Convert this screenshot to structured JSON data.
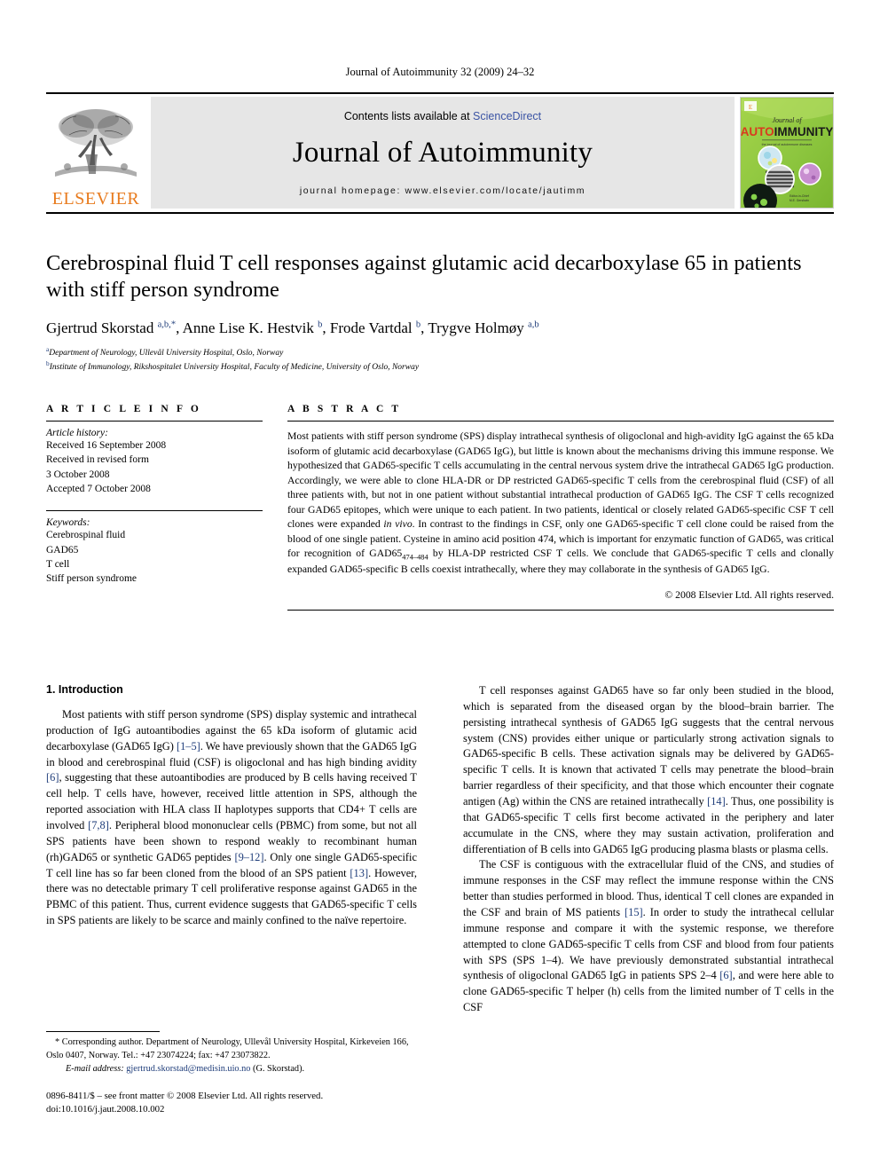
{
  "running_head": "Journal of Autoimmunity 32 (2009) 24–32",
  "banner": {
    "publisher_name": "ELSEVIER",
    "publisher_logo": "elsevier-tree-logo",
    "contents_prefix": "Contents lists available at ",
    "contents_link": "ScienceDirect",
    "journal_name": "Journal of Autoimmunity",
    "homepage": "journal homepage: www.elsevier.com/locate/jautimm",
    "cover": {
      "line1": "Journal of",
      "line2_a": "AUTO",
      "line2_b": "IMMUNITY",
      "subtitle": "the journal of autoimmune diseases",
      "bg_color": "#8dc63f",
      "alt": "journal-cover-thumbnail"
    }
  },
  "article": {
    "title": "Cerebrospinal fluid T cell responses against glutamic acid decarboxylase 65 in patients with stiff person syndrome",
    "authors_html": "Gjertrud Skorstad <sup>a,b,</sup><sup class=\"star\">*</sup>, Anne Lise K. Hestvik <sup>b</sup>, Frode Vartdal <sup>b</sup>, Trygve Holmøy <sup>a,b</sup>",
    "affiliations": [
      {
        "mark": "a",
        "text": "Department of Neurology, Ullevål University Hospital, Oslo, Norway"
      },
      {
        "mark": "b",
        "text": "Institute of Immunology, Rikshospitalet University Hospital, Faculty of Medicine, University of Oslo, Norway"
      }
    ]
  },
  "article_info": {
    "heading": "A R T I C L E   I N F O",
    "history_label": "Article history:",
    "history": [
      "Received 16 September 2008",
      "Received in revised form",
      "3 October 2008",
      "Accepted 7 October 2008"
    ],
    "keywords_label": "Keywords:",
    "keywords": [
      "Cerebrospinal fluid",
      "GAD65",
      "T cell",
      "Stiff person syndrome"
    ]
  },
  "abstract": {
    "heading": "A B S T R A C T",
    "body_html": "Most patients with stiff person syndrome (SPS) display intrathecal synthesis of oligoclonal and high-avidity IgG against the 65 kDa isoform of glutamic acid decarboxylase (GAD65 IgG), but little is known about the mechanisms driving this immune response. We hypothesized that GAD65-specific T cells accumulating in the central nervous system drive the intrathecal GAD65 IgG production. Accordingly, we were able to clone HLA-DR or DP restricted GAD65-specific T cells from the cerebrospinal fluid (CSF) of all three patients with, but not in one patient without substantial intrathecal production of GAD65 IgG. The CSF T cells recognized four GAD65 epitopes, which were unique to each patient. In two patients, identical or closely related GAD65-specific CSF T cell clones were expanded <span class=\"em\">in vivo</span>. In contrast to the findings in CSF, only one GAD65-specific T cell clone could be raised from the blood of one single patient. Cysteine in amino acid position 474, which is important for enzymatic function of GAD65, was critical for recognition of GAD65<sub>474–484</sub> by HLA-DP restricted CSF T cells. We conclude that GAD65-specific T cells and clonally expanded GAD65-specific B cells coexist intrathecally, where they may collaborate in the synthesis of GAD65 IgG.",
    "copyright": "© 2008 Elsevier Ltd. All rights reserved."
  },
  "introduction": {
    "heading": "1. Introduction",
    "left_paragraphs_html": [
      "Most patients with stiff person syndrome (SPS) display systemic and intrathecal production of IgG autoantibodies against the 65 kDa isoform of glutamic acid decarboxylase (GAD65 IgG) <span class=\"ref\">[1–5]</span>. We have previously shown that the GAD65 IgG in blood and cerebrospinal fluid (CSF) is oligoclonal and has high binding avidity <span class=\"ref\">[6]</span>, suggesting that these autoantibodies are produced by B cells having received T cell help. T cells have, however, received little attention in SPS, although the reported association with HLA class II haplotypes supports that CD4+ T cells are involved <span class=\"ref\">[7,8]</span>. Peripheral blood mononuclear cells (PBMC) from some, but not all SPS patients have been shown to respond weakly to recombinant human (rh)GAD65 or synthetic GAD65 peptides <span class=\"ref\">[9–12]</span>. Only one single GAD65-specific T cell line has so far been cloned from the blood of an SPS patient <span class=\"ref\">[13]</span>. However, there was no detectable primary T cell proliferative response against GAD65 in the PBMC of this patient. Thus, current evidence suggests that GAD65-specific T cells in SPS patients are likely to be scarce and mainly confined to the naïve repertoire."
    ],
    "right_paragraphs_html": [
      "T cell responses against GAD65 have so far only been studied in the blood, which is separated from the diseased organ by the blood–brain barrier. The persisting intrathecal synthesis of GAD65 IgG suggests that the central nervous system (CNS) provides either unique or particularly strong activation signals to GAD65-specific B cells. These activation signals may be delivered by GAD65-specific T cells. It is known that activated T cells may penetrate the blood–brain barrier regardless of their specificity, and that those which encounter their cognate antigen (Ag) within the CNS are retained intrathecally <span class=\"ref\">[14]</span>. Thus, one possibility is that GAD65-specific T cells first become activated in the periphery and later accumulate in the CNS, where they may sustain activation, proliferation and differentiation of B cells into GAD65 IgG producing plasma blasts or plasma cells.",
      "The CSF is contiguous with the extracellular fluid of the CNS, and studies of immune responses in the CSF may reflect the immune response within the CNS better than studies performed in blood. Thus, identical T cell clones are expanded in the CSF and brain of MS patients <span class=\"ref\">[15]</span>. In order to study the intrathecal cellular immune response and compare it with the systemic response, we therefore attempted to clone GAD65-specific T cells from CSF and blood from four patients with SPS (SPS 1–4). We have previously demonstrated substantial intrathecal synthesis of oligoclonal GAD65 IgG in patients SPS 2–4 <span class=\"ref\">[6]</span>, and were here able to clone GAD65-specific T helper (h) cells from the limited number of T cells in the CSF"
    ]
  },
  "footnote": {
    "corresponding_html": "* Corresponding author. Department of Neurology, Ullevål University Hospital, Kirkeveien 166, Oslo 0407, Norway. Tel.: +47 23074224; fax: +47 23073822.",
    "email_label": "E-mail address:",
    "email": "gjertrud.skorstad@medisin.uio.no",
    "email_suffix": "(G. Skorstad)."
  },
  "footer": {
    "issn_line": "0896-8411/$ – see front matter © 2008 Elsevier Ltd. All rights reserved.",
    "doi_line": "doi:10.1016/j.jaut.2008.10.002"
  }
}
